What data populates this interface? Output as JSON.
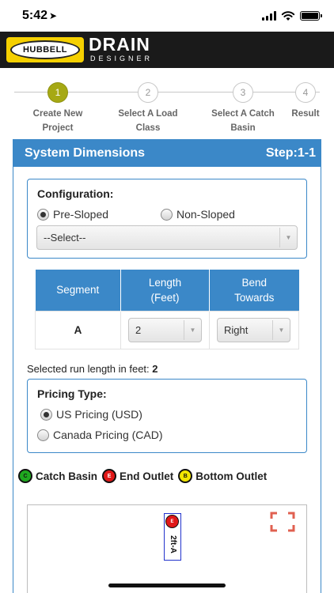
{
  "status_bar": {
    "time": "5:42"
  },
  "header": {
    "logo_text": "HUBBELL",
    "brand_title": "DRAIN",
    "brand_subtitle": "DESIGNER"
  },
  "steps": [
    {
      "number": "1",
      "label_line1": "Create New",
      "label_line2": "Project",
      "active": true
    },
    {
      "number": "2",
      "label_line1": "Select A Load",
      "label_line2": "Class",
      "active": false
    },
    {
      "number": "3",
      "label_line1": "Select A Catch",
      "label_line2": "Basin",
      "active": false
    },
    {
      "number": "4",
      "label_line1": "Result",
      "label_line2": "",
      "active": false
    }
  ],
  "panel": {
    "title": "System Dimensions",
    "step": "Step:1-1"
  },
  "configuration": {
    "title": "Configuration:",
    "option_sloped": "Pre-Sloped",
    "option_nonsloped": "Non-Sloped",
    "selected": "Pre-Sloped",
    "select_value": "--Select--"
  },
  "segments": {
    "headers": {
      "segment": "Segment",
      "length_line1": "Length",
      "length_line2": "(Feet)",
      "bend_line1": "Bend",
      "bend_line2": "Towards"
    },
    "rows": [
      {
        "segment": "A",
        "length": "2",
        "bend": "Right"
      }
    ]
  },
  "run_length": {
    "label": "Selected run length in feet:",
    "value": "2"
  },
  "pricing": {
    "title": "Pricing Type:",
    "option_us": "US Pricing (USD)",
    "option_ca": "Canada Pricing (CAD)",
    "selected": "US Pricing (USD)"
  },
  "legend": [
    {
      "letter": "C",
      "label": "Catch Basin",
      "color": "#1fa81f"
    },
    {
      "letter": "E",
      "label": "End Outlet",
      "color": "#e01818"
    },
    {
      "letter": "B",
      "label": "Bottom Outlet",
      "color": "#f2e600"
    }
  ],
  "drawing": {
    "outlet_letter": "E",
    "pipe_label": "2ft-A"
  },
  "colors": {
    "primary_blue": "#3b88c8",
    "active_step": "#a6a914",
    "header_bg": "#1a1a1a",
    "logo_yellow": "#f5d000"
  }
}
